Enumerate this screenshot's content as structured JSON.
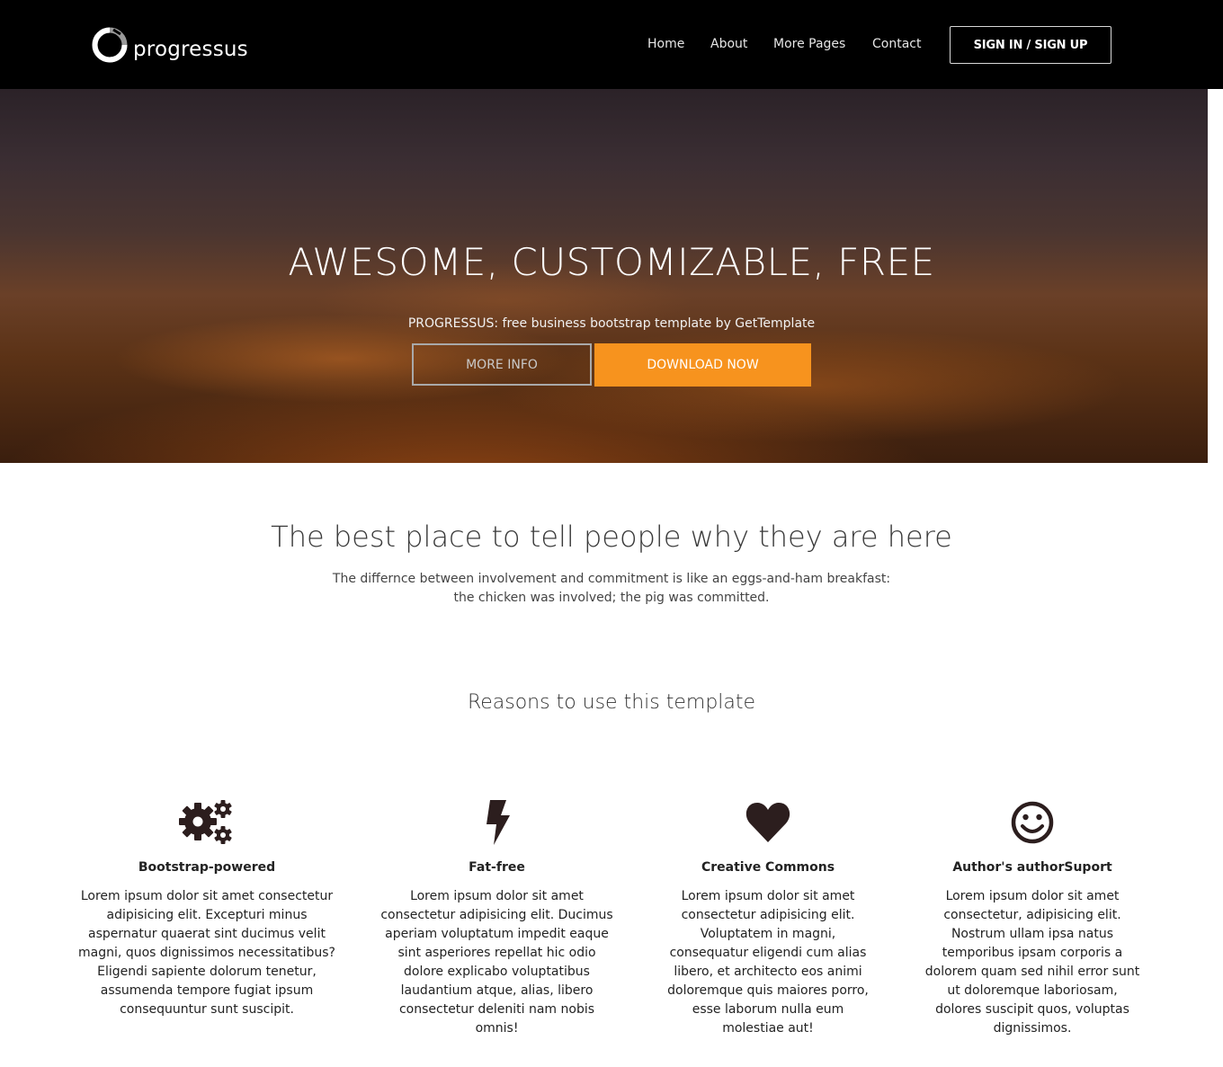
{
  "navbar": {
    "brand": "progressus",
    "links": [
      "Home",
      "About",
      "More Pages",
      "Contact"
    ],
    "signin_label": "SIGN IN / SIGN UP"
  },
  "hero": {
    "title": "AWESOME, CUSTOMIZABLE, FREE",
    "subtitle": "PROGRESSUS: free business bootstrap template by GetTemplate",
    "more_info_label": "MORE INFO",
    "download_label": "DOWNLOAD NOW"
  },
  "intro": {
    "heading": "The best place to tell people why they are here",
    "line1": "The differnce between involvement and commitment is like an eggs-and-ham breakfast:",
    "line2": "the chicken was involved; the pig was committed."
  },
  "reasons": {
    "heading": "Reasons to use this template",
    "features": [
      {
        "icon": "gears-icon",
        "title": "Bootstrap-powered",
        "text": "Lorem ipsum dolor sit amet consectetur adipisicing elit. Excepturi minus aspernatur quaerat sint ducimus velit magni, quos dignissimos necessitatibus? Eligendi sapiente dolorum tenetur, assumenda tempore fugiat ipsum consequuntur sunt suscipit."
      },
      {
        "icon": "flash-icon",
        "title": "Fat-free",
        "text": "Lorem ipsum dolor sit amet consectetur adipisicing elit. Ducimus aperiam voluptatum impedit eaque sint asperiores repellat hic odio dolore explicabo voluptatibus laudantium atque, alias, libero consectetur deleniti nam nobis omnis!"
      },
      {
        "icon": "heart-icon",
        "title": "Creative Commons",
        "text": "Lorem ipsum dolor sit amet consectetur adipisicing elit. Voluptatem in magni, consequatur eligendi cum alias libero, et architecto eos animi doloremque quis maiores porro, esse laborum nulla eum molestiae aut!"
      },
      {
        "icon": "smile-icon",
        "title": "Author's authorSuport",
        "text": "Lorem ipsum dolor sit amet consectetur, adipisicing elit. Nostrum ullam ipsa natus temporibus ipsam corporis a dolorem quam sed nihil error sunt ut doloremque laboriosam, dolores suscipit quos, voluptas dignissimos."
      }
    ]
  },
  "colors": {
    "navbar_bg": "#000000",
    "accent_orange": "#f7931e",
    "icon_dark": "#2c1e1e"
  }
}
